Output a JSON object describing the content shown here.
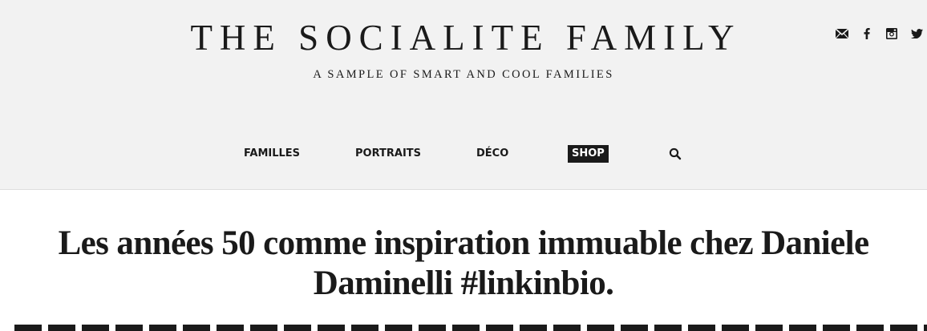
{
  "header": {
    "site_title": "THE SOCIALITE FAMILY",
    "tagline": "A SAMPLE OF SMART AND COOL FAMILIES",
    "social_icons": [
      "mail-icon",
      "facebook-icon",
      "instagram-icon",
      "twitter-icon"
    ]
  },
  "nav": {
    "items": [
      {
        "label": "FAMILLES"
      },
      {
        "label": "PORTRAITS"
      },
      {
        "label": "DÉCO"
      },
      {
        "label": "SHOP",
        "highlighted": true
      }
    ],
    "search_icon": "search-icon"
  },
  "article": {
    "title": "Les années 50 comme inspiration immuable chez Daniele Daminelli #linkinbio."
  },
  "colors": {
    "header_bg": "#f2f2f2",
    "text": "#1a1a1a",
    "shop_bg": "#1a1a1a",
    "shop_text": "#ffffff"
  }
}
